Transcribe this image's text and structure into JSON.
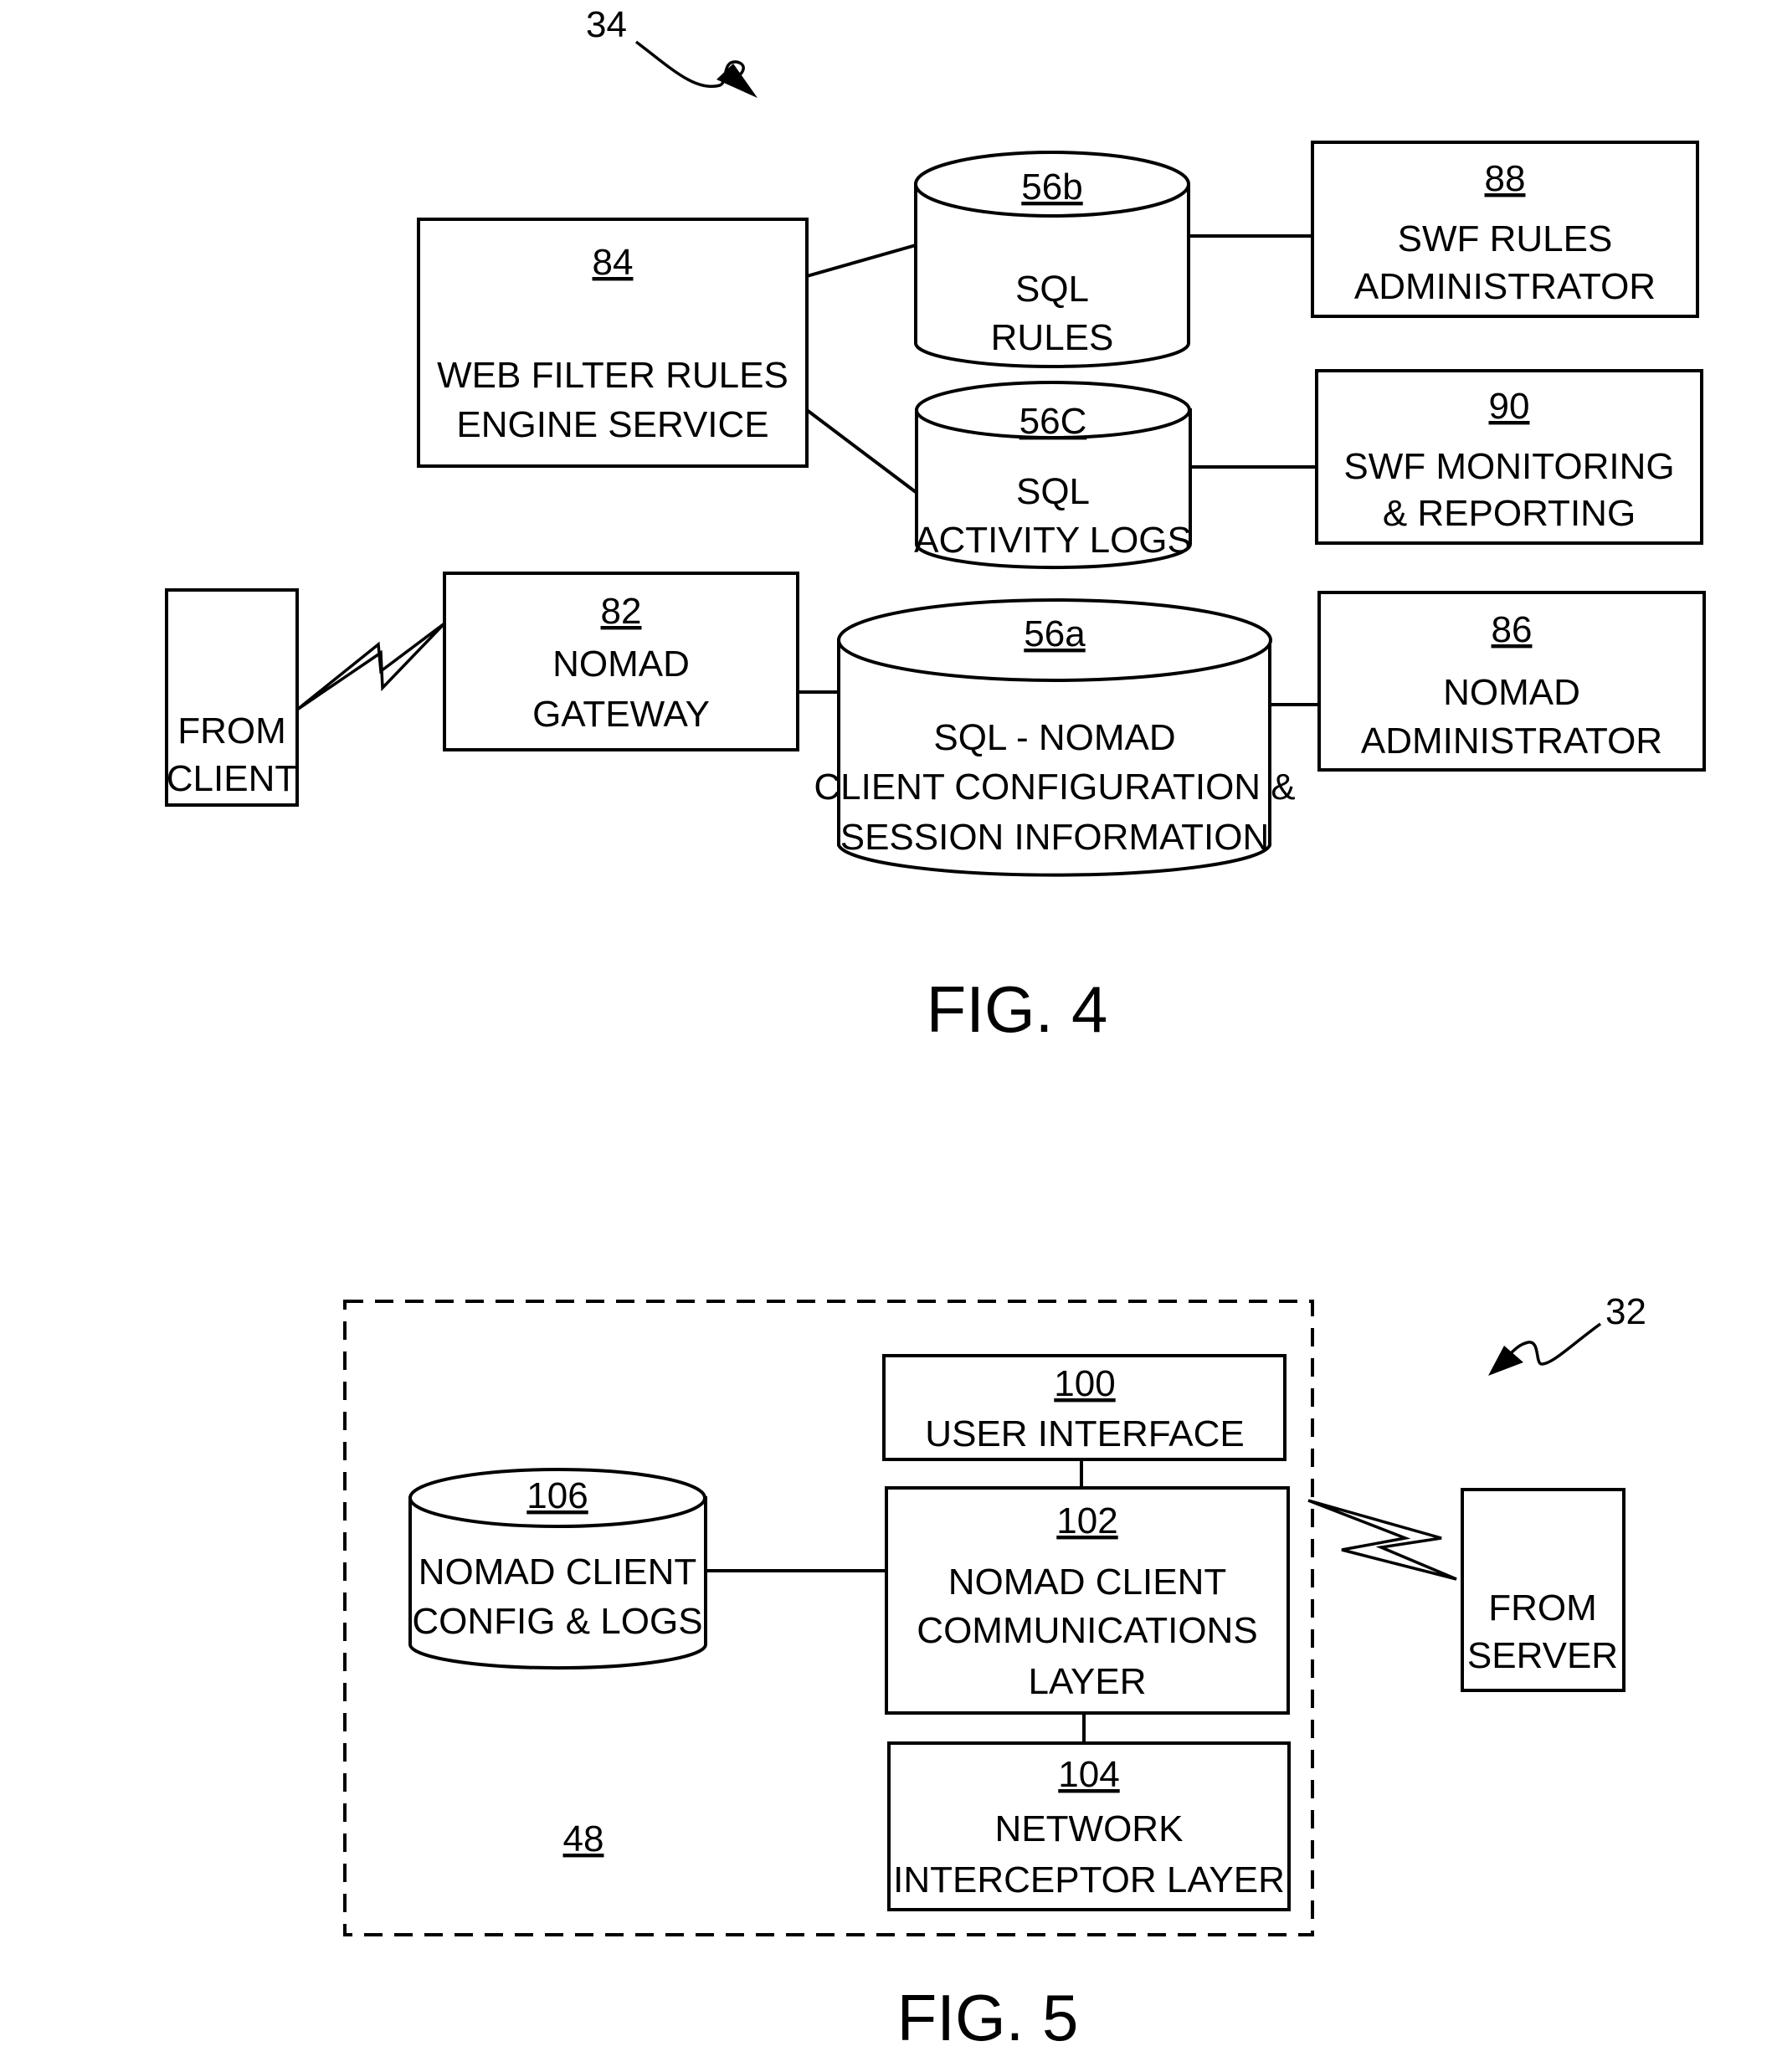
{
  "fig4": {
    "caption": "FIG. 4",
    "callout": "34",
    "nodes": {
      "web_filter": {
        "ref": "84",
        "lines": [
          "WEB FILTER RULES",
          "ENGINE SERVICE"
        ]
      },
      "sql_rules": {
        "ref": "56b",
        "lines": [
          "SQL",
          "RULES"
        ]
      },
      "sql_activity": {
        "ref": "56C",
        "lines": [
          "SQL",
          "ACTIVITY LOGS"
        ]
      },
      "swf_rules_admin": {
        "ref": "88",
        "lines": [
          "SWF RULES",
          "ADMINISTRATOR"
        ]
      },
      "swf_monitoring": {
        "ref": "90",
        "lines": [
          "SWF MONITORING",
          "& REPORTING"
        ]
      },
      "from_client": {
        "lines": [
          "FROM",
          "CLIENT"
        ]
      },
      "nomad_gateway": {
        "ref": "82",
        "lines": [
          "NOMAD",
          "GATEWAY"
        ]
      },
      "sql_nomad": {
        "ref": "56a",
        "lines": [
          "SQL - NOMAD",
          "CLIENT CONFIGURATION &",
          "SESSION INFORMATION"
        ]
      },
      "nomad_admin": {
        "ref": "86",
        "lines": [
          "NOMAD",
          "ADMINISTRATOR"
        ]
      }
    }
  },
  "fig5": {
    "caption": "FIG. 5",
    "callout": "32",
    "container_ref": "48",
    "nodes": {
      "user_interface": {
        "ref": "100",
        "lines": [
          "USER INTERFACE"
        ]
      },
      "comm_layer": {
        "ref": "102",
        "lines": [
          "NOMAD CLIENT",
          "COMMUNICATIONS",
          "LAYER"
        ]
      },
      "interceptor": {
        "ref": "104",
        "lines": [
          "NETWORK",
          "INTERCEPTOR LAYER"
        ]
      },
      "client_config": {
        "ref": "106",
        "lines": [
          "NOMAD CLIENT",
          "CONFIG & LOGS"
        ]
      },
      "from_server": {
        "lines": [
          "FROM",
          "SERVER"
        ]
      }
    }
  }
}
